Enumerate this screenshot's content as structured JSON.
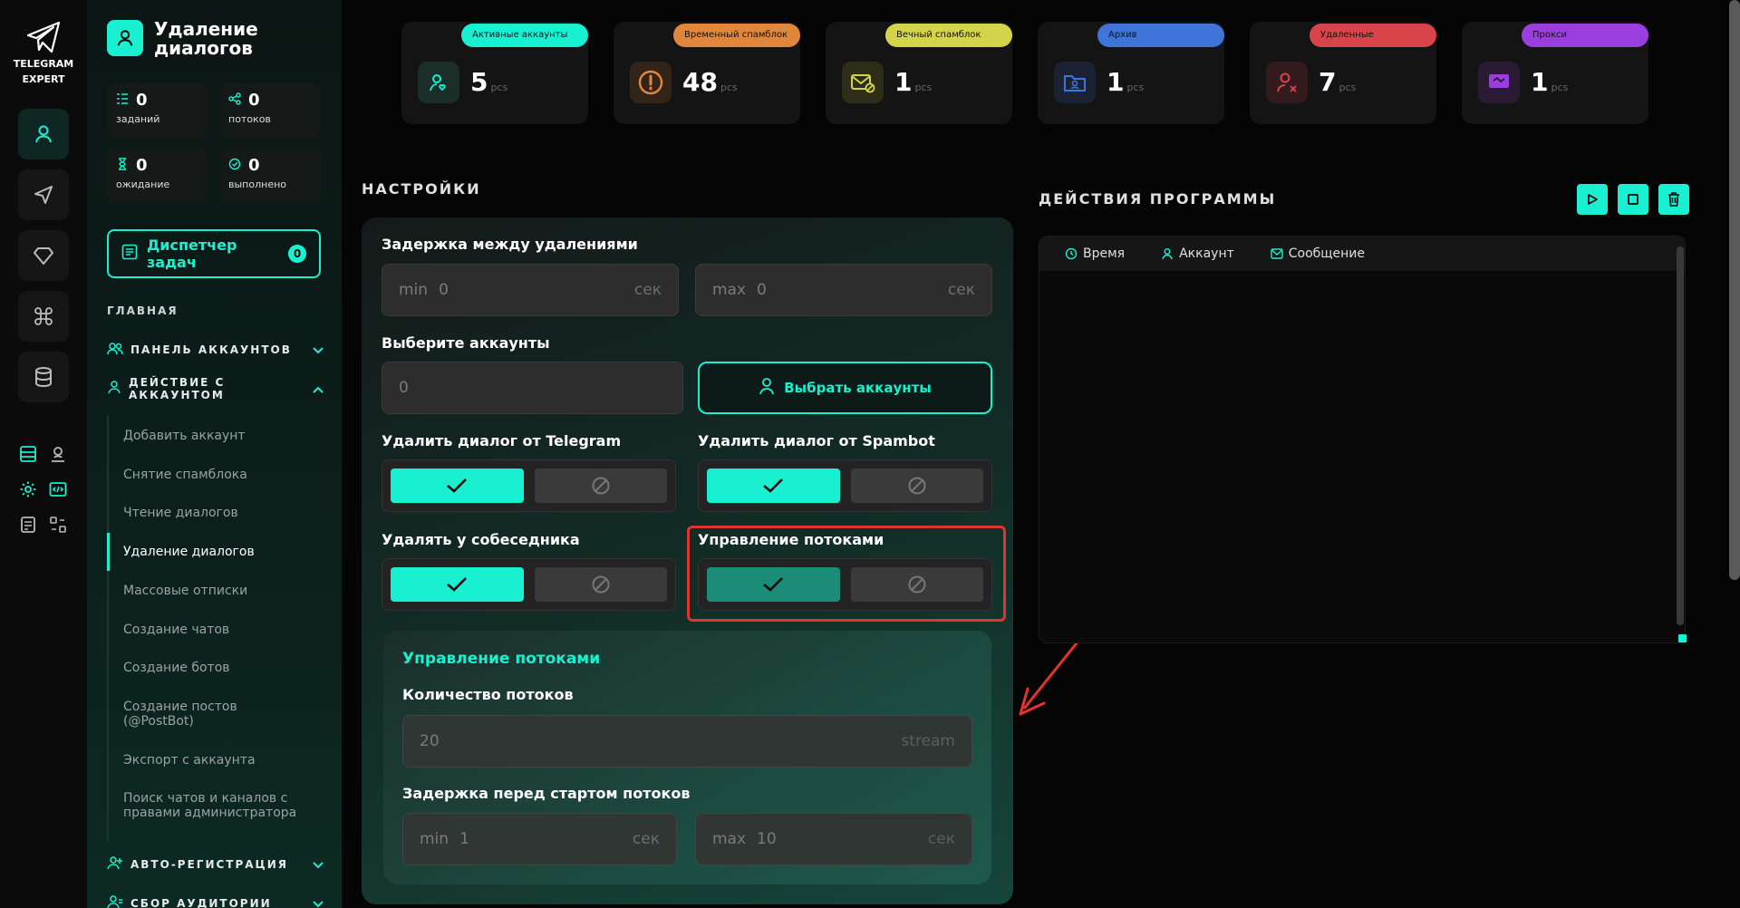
{
  "app": {
    "logo_line1": "TELEGRAM",
    "logo_line2": "EXPERT"
  },
  "sidebar": {
    "page_title": "Удаление диалогов",
    "stats": [
      {
        "value": "0",
        "label": "заданий",
        "icon": "list-icon"
      },
      {
        "value": "0",
        "label": "потоков",
        "icon": "share-icon"
      },
      {
        "value": "0",
        "label": "ожидание",
        "icon": "hourglass-icon"
      },
      {
        "value": "0",
        "label": "выполнено",
        "icon": "check-circle-icon"
      }
    ],
    "dispatcher": {
      "label": "Диспетчер задач",
      "count": "0"
    },
    "section_main": "ГЛАВНАЯ",
    "groups": [
      {
        "label": "ПАНЕЛЬ АККАУНТОВ"
      },
      {
        "label": "ДЕЙСТВИЕ С АККАУНТОМ"
      },
      {
        "label": "АВТО-РЕГИСТРАЦИЯ"
      },
      {
        "label": "СБОР АУДИТОРИИ"
      }
    ],
    "subitems": [
      "Добавить аккаунт",
      "Снятие спамблока",
      "Чтение диалогов",
      "Удаление диалогов",
      "Массовые отписки",
      "Создание чатов",
      "Создание ботов",
      "Создание постов (@PostBot)",
      "Экспорт с аккаунта",
      "Поиск чатов и каналов с правами администратора"
    ]
  },
  "cards": [
    {
      "label": "Активные аккаунты",
      "value": "5",
      "unit": "pcs",
      "color": "#19f0d2"
    },
    {
      "label": "Временный спамблок",
      "value": "48",
      "unit": "pcs",
      "color": "#e0873d"
    },
    {
      "label": "Вечный спамблок",
      "value": "1",
      "unit": "pcs",
      "color": "#d4d44a"
    },
    {
      "label": "Архив",
      "value": "1",
      "unit": "pcs",
      "color": "#3f74d8"
    },
    {
      "label": "Удаленные",
      "value": "7",
      "unit": "pcs",
      "color": "#d9434a"
    },
    {
      "label": "Прокси",
      "value": "1",
      "unit": "pcs",
      "color": "#9b3ee0"
    }
  ],
  "settings": {
    "heading": "НАСТРОЙКИ",
    "delay_label": "Задержка между удалениями",
    "delay_min": {
      "prefix": "min",
      "value": "0",
      "unit": "сек"
    },
    "delay_max": {
      "prefix": "max",
      "value": "0",
      "unit": "сек"
    },
    "accounts_label": "Выберите аккаунты",
    "accounts_value": "0",
    "select_accounts_button": "Выбрать аккаунты",
    "delete_telegram_label": "Удалить диалог от Telegram",
    "delete_spambot_label": "Удалить диалог от Spambot",
    "delete_for_peer_label": "Удалять у собеседника",
    "thread_control_label": "Управление потоками",
    "threads_section_title": "Управление потоками",
    "threads_count_label": "Количество потоков",
    "threads_count": {
      "value": "20",
      "unit": "stream"
    },
    "start_delay_label": "Задержка перед стартом потоков",
    "start_delay_min": {
      "prefix": "min",
      "value": "1",
      "unit": "сек"
    },
    "start_delay_max": {
      "prefix": "max",
      "value": "10",
      "unit": "сек"
    }
  },
  "actions": {
    "heading": "ДЕЙСТВИЯ ПРОГРАММЫ",
    "columns": [
      "Время",
      "Аккаунт",
      "Сообщение"
    ]
  },
  "colors": {
    "accent": "#19f0d2",
    "highlight": "#e2342f"
  }
}
